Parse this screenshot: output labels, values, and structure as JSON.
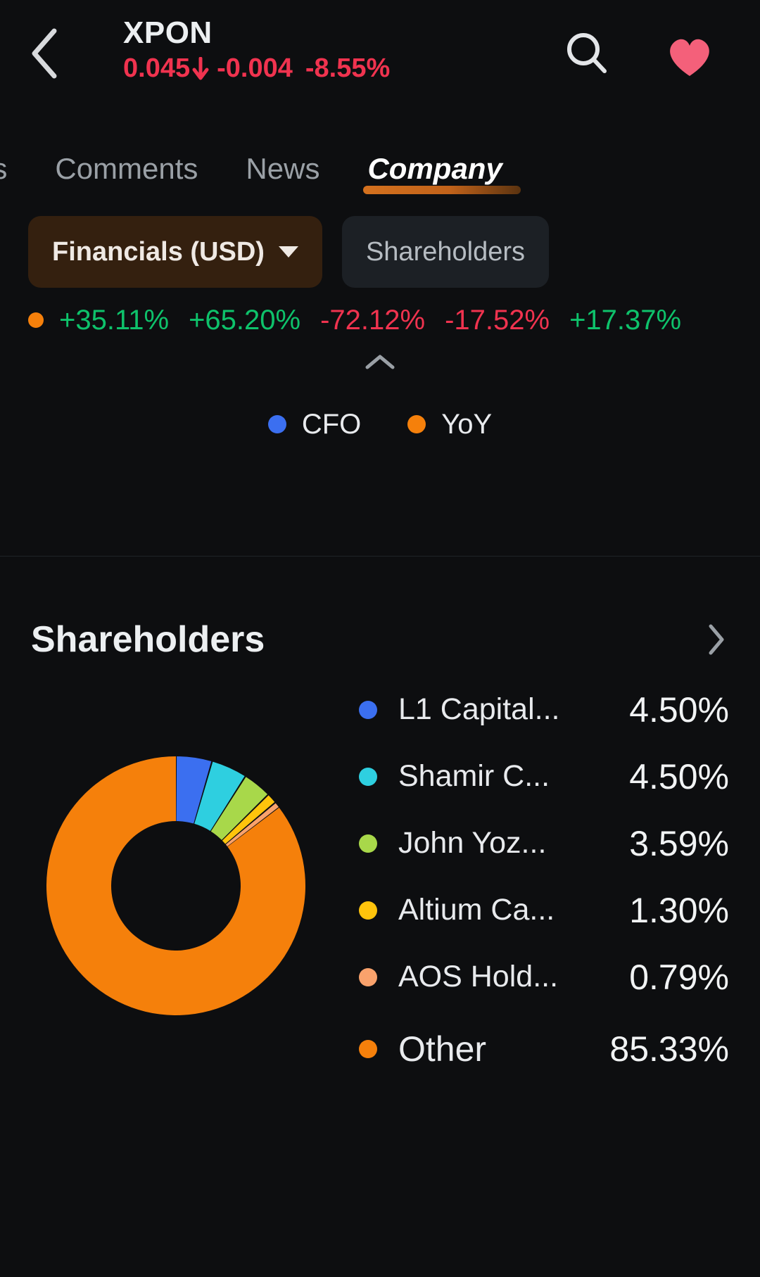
{
  "header": {
    "back_icon": "chevron-left-icon",
    "ticker": "XPON",
    "price": "0.045",
    "direction_icon": "arrow-down-icon",
    "change": "-0.004",
    "change_pct": "-8.55%",
    "change_color": "#f0334f",
    "search_icon": "search-icon",
    "favorite_icon": "heart-icon",
    "favorite_color": "#f4607a"
  },
  "tabs": [
    {
      "label": "ns",
      "active": false
    },
    {
      "label": "Comments",
      "active": false
    },
    {
      "label": "News",
      "active": false
    },
    {
      "label": "Company",
      "active": true
    }
  ],
  "chips": [
    {
      "label": "Financials (USD)",
      "active": true,
      "has_caret": true
    },
    {
      "label": "Shareholders",
      "active": false,
      "has_caret": false
    }
  ],
  "percent_row": {
    "series_dot_color": "#f5800b",
    "values": [
      {
        "text": "+35.11%",
        "dir": "up"
      },
      {
        "text": "+65.20%",
        "dir": "up"
      },
      {
        "text": "-72.12%",
        "dir": "down"
      },
      {
        "text": "-17.52%",
        "dir": "down"
      },
      {
        "text": "+17.37%",
        "dir": "up"
      }
    ]
  },
  "collapse_icon": "chevron-up-icon",
  "mini_legend": [
    {
      "label": "CFO",
      "color": "#3b6ff0"
    },
    {
      "label": "YoY",
      "color": "#f5800b"
    }
  ],
  "shareholders": {
    "title": "Shareholders",
    "more_icon": "chevron-right-icon",
    "chart_data": {
      "type": "pie",
      "title": "Shareholders",
      "donut": true,
      "inner_radius_ratio": 0.5,
      "labels": [
        "L1 Capital...",
        "Shamir C...",
        "John Yoz...",
        "Altium Ca...",
        "AOS Hold...",
        "Other"
      ],
      "values": [
        4.5,
        4.5,
        3.59,
        1.3,
        0.79,
        85.33
      ],
      "value_labels": [
        "4.50%",
        "4.50%",
        "3.59%",
        "1.30%",
        "0.79%",
        "85.33%"
      ],
      "colors": [
        "#3b6ff0",
        "#2ecfe0",
        "#a8d84a",
        "#ffc40c",
        "#f9a26c",
        "#f5800b"
      ],
      "unit": "%",
      "legend": "right"
    }
  }
}
